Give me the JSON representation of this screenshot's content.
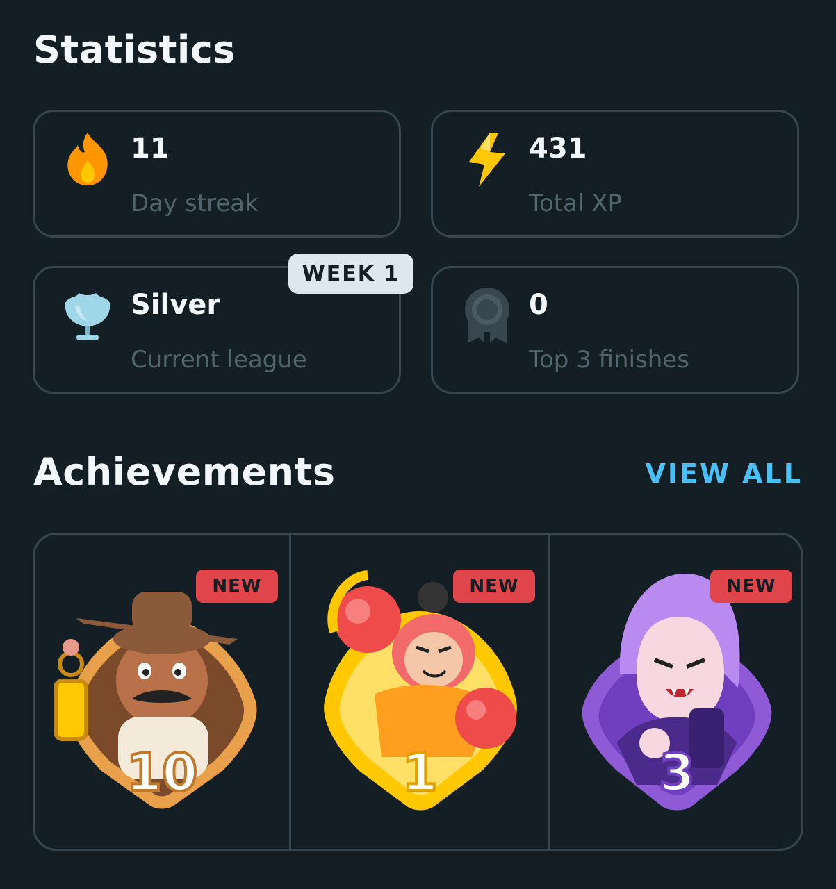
{
  "statistics": {
    "title": "Statistics",
    "cards": [
      {
        "icon": "flame-icon",
        "value": "11",
        "label": "Day streak"
      },
      {
        "icon": "lightning-icon",
        "value": "431",
        "label": "Total XP"
      },
      {
        "icon": "silver-trophy-icon",
        "value": "Silver",
        "label": "Current league",
        "badge": "WEEK 1"
      },
      {
        "icon": "medal-icon",
        "value": "0",
        "label": "Top 3 finishes"
      }
    ]
  },
  "achievements": {
    "title": "Achievements",
    "view_all": "VIEW ALL",
    "items": [
      {
        "icon": "explorer-achievement-icon",
        "level": "10",
        "badge": "NEW",
        "color": "#e8a04a"
      },
      {
        "icon": "boxer-achievement-icon",
        "level": "1",
        "badge": "NEW",
        "color": "#ffc800"
      },
      {
        "icon": "vampire-achievement-icon",
        "level": "3",
        "badge": "NEW",
        "color": "#8e5ad6"
      }
    ]
  },
  "colors": {
    "background": "#131f24",
    "border": "#37464f",
    "label": "#52656d",
    "accent": "#49c0f8",
    "new_badge": "#e0454b"
  }
}
